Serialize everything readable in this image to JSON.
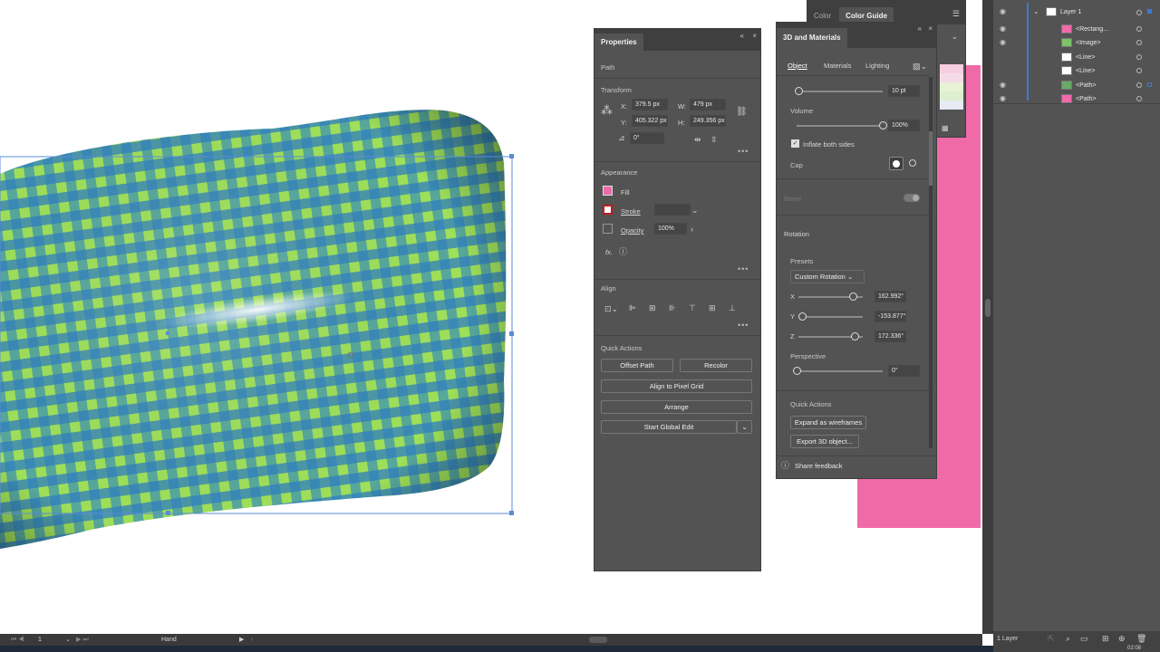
{
  "colors": {
    "pink": "#f06aa8",
    "panel": "#535353",
    "accent": "#3a7bd5"
  },
  "properties": {
    "title": "Properties",
    "object_type": "Path",
    "transform_label": "Transform",
    "x_label": "X:",
    "x_value": "379.5 px",
    "w_label": "W:",
    "w_value": "479 px",
    "y_label": "Y:",
    "y_value": "405.322 px",
    "h_label": "H:",
    "h_value": "249.356 px",
    "angle_value": "0°",
    "appearance_label": "Appearance",
    "fill_label": "Fill",
    "stroke_label": "Stroke",
    "opacity_label": "Opacity",
    "opacity_value": "100%",
    "fx_label": "fx.",
    "align_label": "Align",
    "quick_actions_label": "Quick Actions",
    "offset_path": "Offset Path",
    "recolor": "Recolor",
    "align_pixel": "Align to Pixel Grid",
    "arrange": "Arrange",
    "start_global_edit": "Start Global Edit"
  },
  "color_panel": {
    "tab_color": "Color",
    "tab_guide": "Color Guide"
  },
  "materials": {
    "title": "3D and Materials",
    "tab_object": "Object",
    "tab_materials": "Materials",
    "tab_lighting": "Lighting",
    "depth_value": "10 pt",
    "volume_label": "Volume",
    "volume_value": "100%",
    "inflate_label": "Inflate both sides",
    "cap_label": "Cap",
    "bevel_label": "Bevel",
    "rotation_label": "Rotation",
    "presets_label": "Presets",
    "preset_value": "Custom Rotation",
    "x_label": "X",
    "x_value": "162.992°",
    "y_label": "Y",
    "y_value": "-153.877°",
    "z_label": "Z",
    "z_value": "172.336°",
    "perspective_label": "Perspective",
    "perspective_value": "0°",
    "quick_actions_label": "Quick Actions",
    "expand_wireframes": "Expand as wireframes",
    "export_3d": "Export 3D object...",
    "share_feedback": "Share feedback",
    "volume_level": 1.0,
    "x_level": 0.85,
    "y_level": 0.05,
    "z_level": 0.88,
    "perspective_level": 0.0
  },
  "layers": {
    "layer_name": "Layer 1",
    "items": [
      {
        "name": "<Rectang..."
      },
      {
        "name": "<Image>"
      },
      {
        "name": "<Line>"
      },
      {
        "name": "<Line>"
      },
      {
        "name": "<Path>"
      },
      {
        "name": "<Path>"
      }
    ],
    "footer": "1 Layer"
  },
  "statusbar": {
    "artboard": "1",
    "tool": "Hand"
  },
  "clock": "02:08"
}
